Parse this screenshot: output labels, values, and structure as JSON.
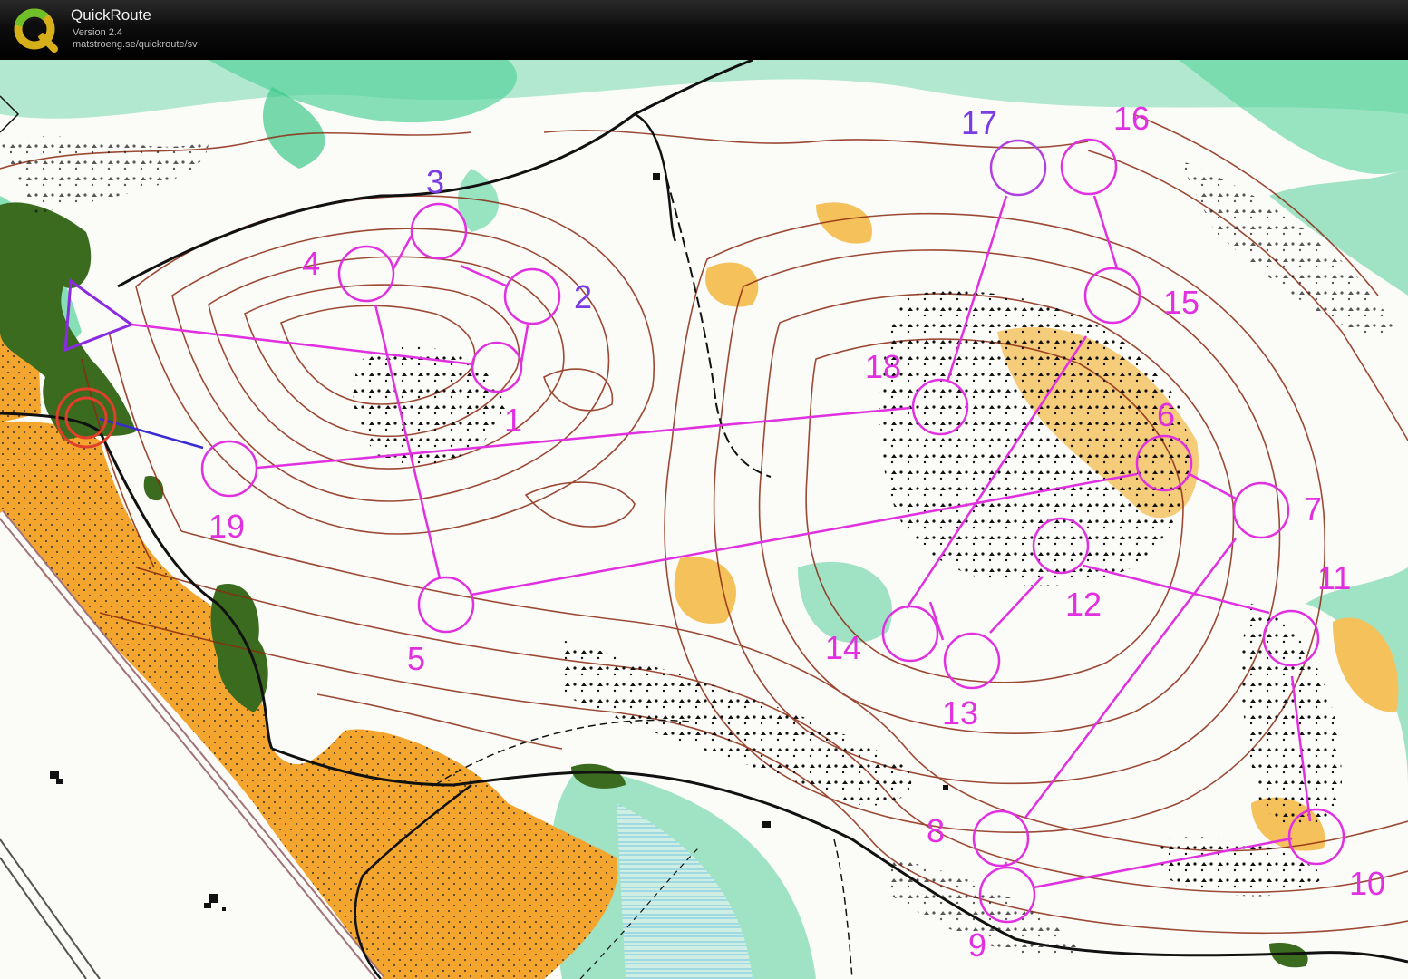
{
  "app": {
    "title": "QuickRoute",
    "version": "Version 2.4",
    "url": "matstroeng.se/quickroute/sv"
  },
  "colors": {
    "course": "#e030e0",
    "course_purple": "#8a2be2",
    "forest_green": "#3a6b1e",
    "open_yellow": "#f4a52e",
    "vegetation": "#56d39b",
    "contour": "#8b2a12"
  },
  "course": {
    "controls": [
      {
        "label": "1"
      },
      {
        "label": "2"
      },
      {
        "label": "3"
      },
      {
        "label": "4"
      },
      {
        "label": "5"
      },
      {
        "label": "6"
      },
      {
        "label": "7"
      },
      {
        "label": "8"
      },
      {
        "label": "9"
      },
      {
        "label": "10"
      },
      {
        "label": "11"
      },
      {
        "label": "12"
      },
      {
        "label": "13"
      },
      {
        "label": "14"
      },
      {
        "label": "15"
      },
      {
        "label": "16"
      },
      {
        "label": "17"
      },
      {
        "label": "18"
      },
      {
        "label": "19"
      }
    ]
  }
}
